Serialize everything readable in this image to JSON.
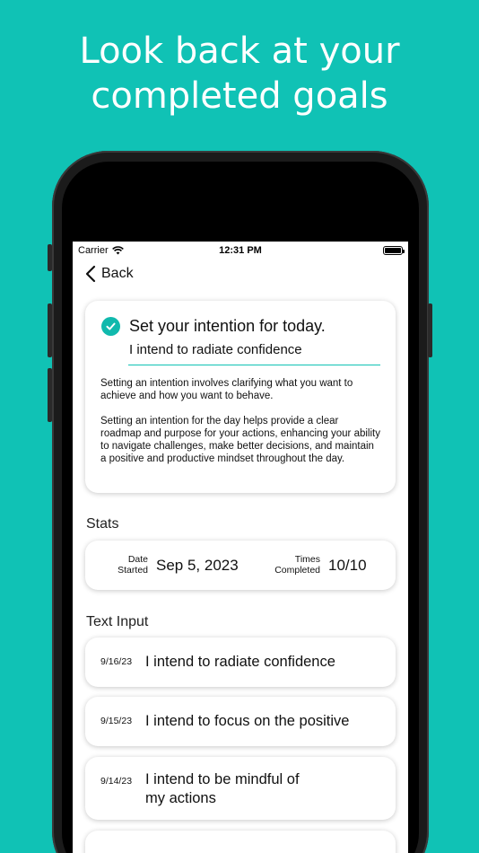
{
  "headline": {
    "line1": "Look back at your",
    "line2": "completed goals"
  },
  "status_bar": {
    "carrier": "Carrier",
    "time": "12:31 PM"
  },
  "nav": {
    "back_label": "Back"
  },
  "intention": {
    "title": "Set your intention for today.",
    "input_value": "I intend to radiate confidence",
    "description_1": "Setting an intention involves clarifying what you want to achieve and how you want to behave.",
    "description_2": "Setting an intention for the day helps provide a clear roadmap and purpose for your actions, enhancing your ability to navigate challenges, make better decisions, and maintain a positive and productive mindset throughout the day."
  },
  "stats": {
    "section_title": "Stats",
    "date_started_label_1": "Date",
    "date_started_label_2": "Started",
    "date_started_value": "Sep 5, 2023",
    "times_completed_label_1": "Times",
    "times_completed_label_2": "Completed",
    "times_completed_value": "10/10"
  },
  "text_input": {
    "section_title": "Text Input",
    "entries": [
      {
        "date": "9/16/23",
        "text": "I intend to radiate confidence"
      },
      {
        "date": "9/15/23",
        "text": "I intend to focus on the positive"
      },
      {
        "date": "9/14/23",
        "text": "I intend to be mindful of my actions"
      }
    ]
  },
  "colors": {
    "background": "#10c2b5",
    "accent": "#10b9ad"
  }
}
